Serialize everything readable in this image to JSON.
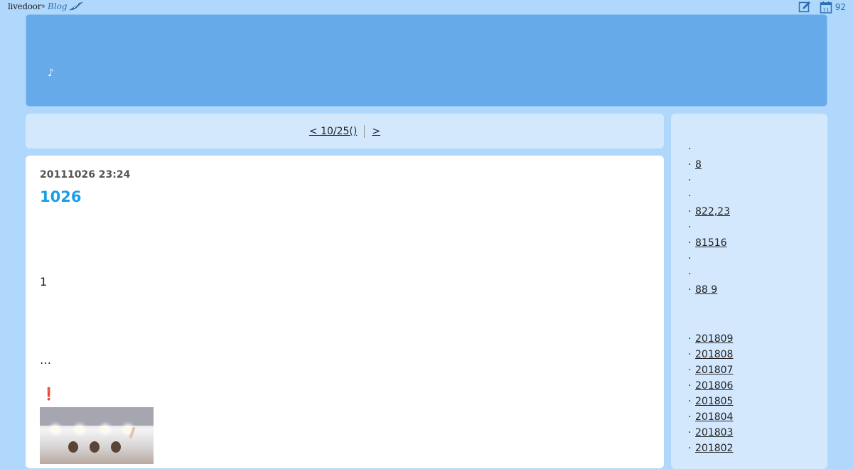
{
  "topbar": {
    "logo_word": "livedoor",
    "logo_reg": "®",
    "logo_blog": "Blog",
    "notif_count": "92"
  },
  "banner": {
    "note": "♪"
  },
  "pager": {
    "prev_label": "< 10/25() ",
    "next_label": " > "
  },
  "post": {
    "date": "20111026 23:24",
    "title": "1026",
    "line1": "1",
    "line2": "…",
    "excl": "❗"
  },
  "sidebar": {
    "recent": [
      "",
      "8",
      "",
      "",
      "822,23",
      "",
      "81516",
      "",
      "",
      "88 9"
    ],
    "archives": [
      "201809",
      "201808",
      "201807",
      "201806",
      "201805",
      "201804",
      "201803",
      "201802"
    ]
  }
}
